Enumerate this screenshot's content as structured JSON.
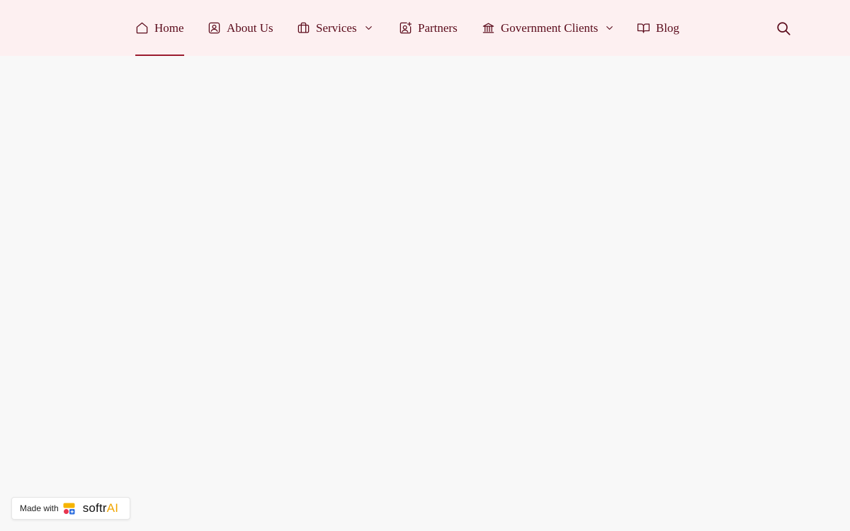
{
  "nav": {
    "items": [
      {
        "label": "Home",
        "icon": "home-icon",
        "active": true
      },
      {
        "label": "About Us",
        "icon": "contact-card-icon"
      },
      {
        "label": "Services",
        "icon": "briefcase-icon",
        "dropdown": true
      },
      {
        "label": "Partners",
        "icon": "user-plus-icon"
      },
      {
        "label": "Government Clients",
        "icon": "bank-icon",
        "dropdown": true
      },
      {
        "label": "Blog",
        "icon": "book-open-icon"
      }
    ],
    "search_icon": "search-icon"
  },
  "badge": {
    "prefix": "Made with",
    "brand": "softr",
    "brand_suffix": "AI"
  },
  "colors": {
    "nav_background": "#fdf0f1",
    "nav_text": "#5a0a1a",
    "active_underline": "#9b1b2e",
    "page_background": "#f8f8f8",
    "brand_accent": "#f0a500"
  }
}
